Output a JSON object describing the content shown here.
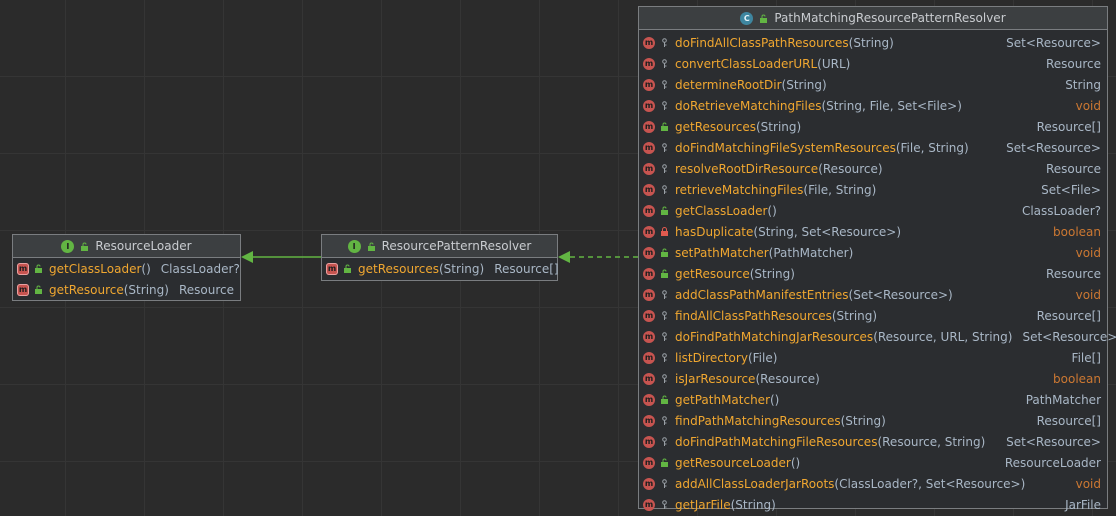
{
  "colors": {
    "background": "#2b2b2b",
    "method_name": "#f0a730",
    "keyword": "#cc7832",
    "public_access": "#62b543",
    "private_access": "#9aa0a6",
    "lock_access": "#e05a4f",
    "arrow": "#62b543"
  },
  "resource_loader": {
    "title": "ResourceLoader",
    "kind_icon": "interface-icon",
    "methods": [
      {
        "name": "getClassLoader",
        "params": "()",
        "ret": "ClassLoader?",
        "access": "public",
        "abstract": true
      },
      {
        "name": "getResource",
        "params": "(String)",
        "ret": "Resource",
        "access": "public",
        "abstract": true
      }
    ]
  },
  "resource_pattern_resolver": {
    "title": "ResourcePatternResolver",
    "kind_icon": "interface-icon",
    "methods": [
      {
        "name": "getResources",
        "params": "(String)",
        "ret": "Resource[]",
        "access": "public",
        "abstract": true
      }
    ]
  },
  "path_matching": {
    "title": "PathMatchingResourcePatternResolver",
    "kind_icon": "class-icon",
    "methods": [
      {
        "name": "doFindAllClassPathResources",
        "params": "(String)",
        "ret": "Set<Resource>",
        "access": "private"
      },
      {
        "name": "convertClassLoaderURL",
        "params": "(URL)",
        "ret": "Resource",
        "access": "private"
      },
      {
        "name": "determineRootDir",
        "params": "(String)",
        "ret": "String",
        "access": "private"
      },
      {
        "name": "doRetrieveMatchingFiles",
        "params": "(String, File, Set<File>)",
        "ret": "void",
        "access": "private",
        "kw": true
      },
      {
        "name": "getResources",
        "params": "(String)",
        "ret": "Resource[]",
        "access": "public"
      },
      {
        "name": "doFindMatchingFileSystemResources",
        "params": "(File, String)",
        "ret": "Set<Resource>",
        "access": "private"
      },
      {
        "name": "resolveRootDirResource",
        "params": "(Resource)",
        "ret": "Resource",
        "access": "private"
      },
      {
        "name": "retrieveMatchingFiles",
        "params": "(File, String)",
        "ret": "Set<File>",
        "access": "private"
      },
      {
        "name": "getClassLoader",
        "params": "()",
        "ret": "ClassLoader?",
        "access": "public"
      },
      {
        "name": "hasDuplicate",
        "params": "(String, Set<Resource>)",
        "ret": "boolean",
        "access": "locked",
        "kw": true
      },
      {
        "name": "setPathMatcher",
        "params": "(PathMatcher)",
        "ret": "void",
        "access": "public",
        "kw": true
      },
      {
        "name": "getResource",
        "params": "(String)",
        "ret": "Resource",
        "access": "public"
      },
      {
        "name": "addClassPathManifestEntries",
        "params": "(Set<Resource>)",
        "ret": "void",
        "access": "private",
        "kw": true
      },
      {
        "name": "findAllClassPathResources",
        "params": "(String)",
        "ret": "Resource[]",
        "access": "private"
      },
      {
        "name": "doFindPathMatchingJarResources",
        "params": "(Resource, URL, String)",
        "ret": "Set<Resource>",
        "access": "private"
      },
      {
        "name": "listDirectory",
        "params": "(File)",
        "ret": "File[]",
        "access": "private"
      },
      {
        "name": "isJarResource",
        "params": "(Resource)",
        "ret": "boolean",
        "access": "private",
        "kw": true
      },
      {
        "name": "getPathMatcher",
        "params": "()",
        "ret": "PathMatcher",
        "access": "public"
      },
      {
        "name": "findPathMatchingResources",
        "params": "(String)",
        "ret": "Resource[]",
        "access": "private"
      },
      {
        "name": "doFindPathMatchingFileResources",
        "params": "(Resource, String)",
        "ret": "Set<Resource>",
        "access": "private"
      },
      {
        "name": "getResourceLoader",
        "params": "()",
        "ret": "ResourceLoader",
        "access": "public"
      },
      {
        "name": "addAllClassLoaderJarRoots",
        "params": "(ClassLoader?, Set<Resource>)",
        "ret": "void",
        "access": "private",
        "kw": true
      },
      {
        "name": "getJarFile",
        "params": "(String)",
        "ret": "JarFile",
        "access": "private"
      }
    ]
  }
}
